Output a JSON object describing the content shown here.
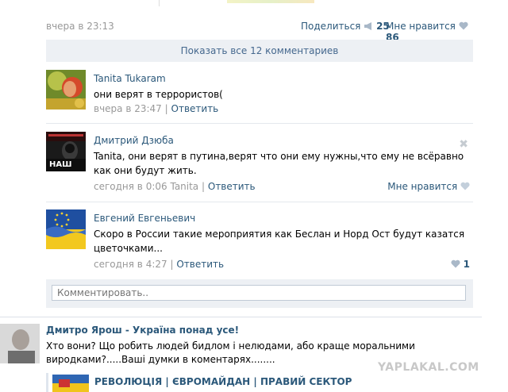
{
  "post": {
    "time": "вчера в 23:13",
    "share_label": "Поделиться",
    "share_count": "25",
    "like_label": "Мне нравится",
    "like_count": "86"
  },
  "show_all": "Показать все 12 комментариев",
  "comments": [
    {
      "author": "Tanita Tukaram",
      "text": "они верят в террористов(",
      "time": "вчера в 23:47",
      "reply_label": "Ответить"
    },
    {
      "author": "Дмитрий Дзюба",
      "text": "Tanita, они верят в путина,верят что они ему нужны,что ему не всёравно как они будут жить.",
      "time": "сегодня в 0:06",
      "reply_to": "Tanita",
      "reply_label": "Ответить",
      "like_label": "Мне нравится",
      "avatar_text": "НАШ"
    },
    {
      "author": "Евгений Евгеньевич",
      "text": "Скоро в России такие мероприятия как Беслан и Норд Ост будут казатся цветочками...",
      "time": "сегодня в 4:27",
      "reply_label": "Ответить",
      "like_count": "1"
    }
  ],
  "comment_input": {
    "placeholder": "Комментировать.."
  },
  "post2": {
    "author": "Дмитро Ярош - Україна понад усе!",
    "text": "Хто вони? Що робить людей бидлом і нелюдами, або краще моральними виродками?.....Ваші думки в коментарях........",
    "repost_title": "РЕВОЛЮЦІЯ | ЄВРОМАЙДАН | ПРАВИЙ СЕКТОР"
  },
  "watermark": "YAPLAKAL.COM",
  "colors": {
    "link": "#2b587a",
    "muted": "#999999",
    "panel": "#edf0f4"
  }
}
